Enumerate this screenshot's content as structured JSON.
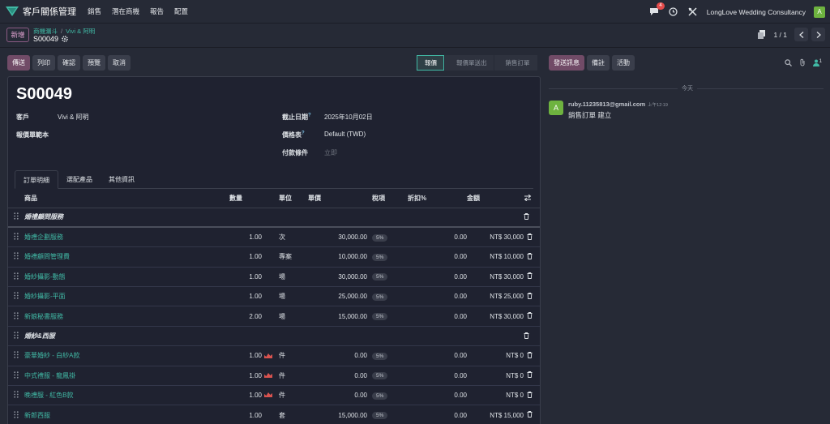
{
  "nav": {
    "app_title": "客戶關係管理",
    "menu": [
      "銷售",
      "潛在商機",
      "報告",
      "配置"
    ],
    "chat_badge": "4",
    "company": "LongLove Wedding Consultancy",
    "avatar_letter": "A",
    "brand_color": "#714b67",
    "accent_color": "#41b9a5"
  },
  "control": {
    "new_label": "新增",
    "breadcrumb": [
      "商機漏斗",
      "Vivi & 阿明"
    ],
    "record": "S00049",
    "pager": "1 / 1"
  },
  "actions": {
    "buttons": [
      "傳送",
      "列印",
      "確認",
      "預覽",
      "取消"
    ],
    "status_steps": [
      "報價",
      "報價單送出",
      "銷售訂單"
    ],
    "active_step": "報價"
  },
  "form": {
    "title": "S00049",
    "customer_label": "客戶",
    "customer_value": "Vivi & 阿明",
    "template_label": "報價單範本",
    "expiry_label": "截止日期",
    "expiry_value": "2025年10月02日",
    "pricelist_label": "價格表",
    "pricelist_value": "Default (TWD)",
    "payment_label": "付款條件",
    "payment_placeholder": "立即",
    "help_mark": "?"
  },
  "tabs": [
    "訂單明細",
    "選配產品",
    "其他資訊"
  ],
  "columns": {
    "product": "商品",
    "qty": "數量",
    "uom": "單位",
    "price": "單價",
    "taxes": "稅項",
    "discount": "折扣%",
    "amount": "金額"
  },
  "lines": [
    {
      "kind": "section",
      "name": "婚禮顧問服務"
    },
    {
      "kind": "line",
      "name": "婚禮企劃服務",
      "qty": "1.00",
      "uom": "次",
      "price": "30,000.00",
      "tax": "5%",
      "discount": "0.00",
      "amount": "NT$ 30,000",
      "forecast": false
    },
    {
      "kind": "line",
      "name": "婚禮顧問管理費",
      "qty": "1.00",
      "uom": "專案",
      "price": "10,000.00",
      "tax": "5%",
      "discount": "0.00",
      "amount": "NT$ 10,000",
      "forecast": false
    },
    {
      "kind": "line",
      "name": "婚紗攝影-動態",
      "qty": "1.00",
      "uom": "場",
      "price": "30,000.00",
      "tax": "5%",
      "discount": "0.00",
      "amount": "NT$ 30,000",
      "forecast": false
    },
    {
      "kind": "line",
      "name": "婚紗攝影-平面",
      "qty": "1.00",
      "uom": "場",
      "price": "25,000.00",
      "tax": "5%",
      "discount": "0.00",
      "amount": "NT$ 25,000",
      "forecast": false
    },
    {
      "kind": "line",
      "name": "新娘秘書服務",
      "qty": "2.00",
      "uom": "場",
      "price": "15,000.00",
      "tax": "5%",
      "discount": "0.00",
      "amount": "NT$ 30,000",
      "forecast": false
    },
    {
      "kind": "section",
      "name": "婚紗&西服"
    },
    {
      "kind": "line",
      "name": "豪華婚紗 - 白紗A款",
      "qty": "1.00",
      "uom": "件",
      "price": "0.00",
      "tax": "5%",
      "discount": "0.00",
      "amount": "NT$ 0",
      "forecast": true
    },
    {
      "kind": "line",
      "name": "中式禮服 - 龍鳳褂",
      "qty": "1.00",
      "uom": "件",
      "price": "0.00",
      "tax": "5%",
      "discount": "0.00",
      "amount": "NT$ 0",
      "forecast": true
    },
    {
      "kind": "line",
      "name": "晚禮服 - 紅色B款",
      "qty": "1.00",
      "uom": "件",
      "price": "0.00",
      "tax": "5%",
      "discount": "0.00",
      "amount": "NT$ 0",
      "forecast": true
    },
    {
      "kind": "line",
      "name": "新郎西服",
      "qty": "1.00",
      "uom": "套",
      "price": "15,000.00",
      "tax": "5%",
      "discount": "0.00",
      "amount": "NT$ 15,000",
      "forecast": false
    }
  ],
  "chatter": {
    "buttons": [
      "發送訊息",
      "備註",
      "活動"
    ],
    "follower_count": "1",
    "today_label": "今天",
    "author": "ruby.11235813@gmail.com",
    "time": "上午12:19",
    "avatar_letter": "A",
    "body": "銷售訂單 建立"
  }
}
